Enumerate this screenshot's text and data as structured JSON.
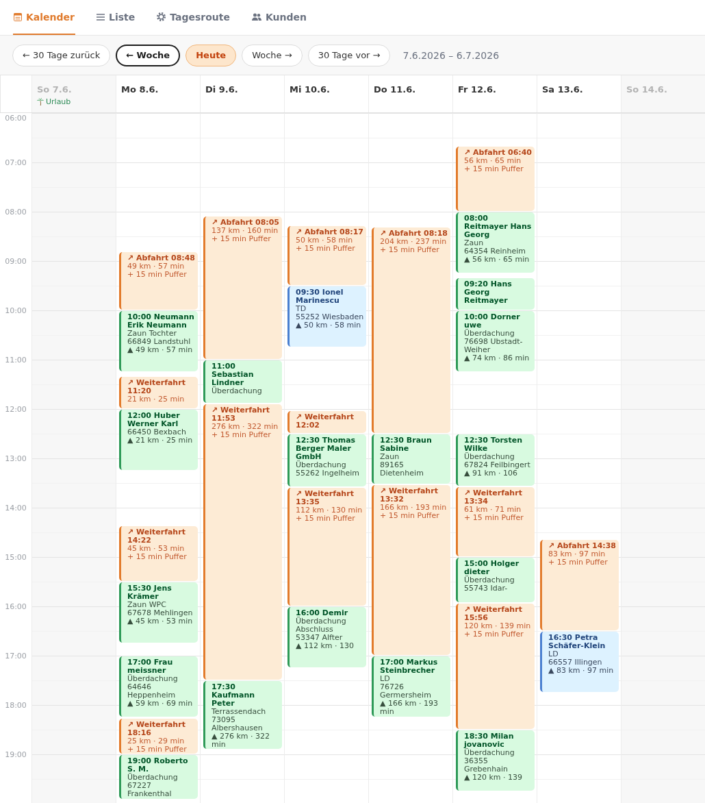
{
  "tabs": [
    {
      "label": "Kalender",
      "selected": true
    },
    {
      "label": "Liste",
      "selected": false
    },
    {
      "label": "Tagesroute",
      "selected": false
    },
    {
      "label": "Kunden",
      "selected": false
    }
  ],
  "toolbar": {
    "buttons": [
      {
        "label": "← 30 Tage zurück",
        "kind": "plain"
      },
      {
        "label": "← Woche",
        "kind": "focused"
      },
      {
        "label": "Heute",
        "kind": "today"
      },
      {
        "label": "Woche →",
        "kind": "plain"
      },
      {
        "label": "30 Tage vor →",
        "kind": "plain"
      }
    ],
    "range": "7.6.2026 – 6.7.2026"
  },
  "time_labels": [
    "06:00",
    "07:00",
    "08:00",
    "09:00",
    "10:00",
    "11:00",
    "12:00",
    "13:00",
    "14:00",
    "15:00",
    "16:00",
    "17:00",
    "18:00",
    "19:00"
  ],
  "days": [
    {
      "label": "So 7.6.",
      "disabled": true,
      "note": "Urlaub"
    },
    {
      "label": "Mo 8.6.",
      "disabled": false,
      "events": [
        {
          "kind": "travel",
          "title": "↗ Abfahrt 08:48",
          "lines": [
            "49 km · 57 min",
            "+ 15 min Puffer"
          ]
        },
        {
          "kind": "appointment",
          "color": "#2f9a58",
          "title": "10:00 Neumann Erik Neumann",
          "lines": [
            "Zaun Tochter",
            "66849 Landstuhl",
            "▲ 49 km · 57 min"
          ]
        },
        {
          "kind": "travel",
          "title": "↗ Weiterfahrt 11:20",
          "lines": [
            "21 km · 25 min"
          ]
        },
        {
          "kind": "appointment",
          "color": "#2f9a58",
          "title": "12:00 Huber Werner Karl",
          "lines": [
            "66450 Bexbach",
            "▲ 21 km · 25 min"
          ]
        },
        {
          "kind": "travel",
          "title": "↗ Weiterfahrt 14:22",
          "lines": [
            "45 km · 53 min",
            "+ 15 min Puffer"
          ]
        },
        {
          "kind": "appointment",
          "color": "#2f9a58",
          "title": "15:30 Jens Krämer",
          "lines": [
            "Zaun WPC",
            "67678 Mehlingen",
            "▲ 45 km · 53 min"
          ]
        },
        {
          "kind": "appointment",
          "color": "#2f9a58",
          "title": "17:00 Frau meissner",
          "lines": [
            "Überdachung",
            "64646 Heppenheim",
            "▲ 59 km · 69 min"
          ]
        },
        {
          "kind": "travel",
          "title": "↗ Weiterfahrt 18:16",
          "lines": [
            "25 km · 29 min",
            "+ 15 min Puffer"
          ]
        },
        {
          "kind": "appointment",
          "color": "#2f9a58",
          "title": "19:00 Roberto S. M.",
          "lines": [
            "Überdachung",
            "67227 Frankenthal"
          ]
        }
      ]
    },
    {
      "label": "Di 9.6.",
      "disabled": false,
      "events": [
        {
          "kind": "travel",
          "title": "↗ Abfahrt 08:05",
          "lines": [
            "137 km · 160 min",
            "+ 15 min Puffer"
          ]
        },
        {
          "kind": "appointment",
          "color": "#2f9a58",
          "title": "11:00 Sebastian Lindner",
          "lines": [
            "Überdachung"
          ]
        },
        {
          "kind": "travel",
          "title": "↗ Weiterfahrt 11:53",
          "lines": [
            "276 km · 322 min",
            "+ 15 min Puffer"
          ]
        },
        {
          "kind": "appointment",
          "color": "#2f9a58",
          "title": "17:30 Kaufmann Peter",
          "lines": [
            "Terrassendach",
            "73095 Albershausen",
            "▲ 276 km · 322 min"
          ]
        }
      ]
    },
    {
      "label": "Mi 10.6.",
      "disabled": false,
      "events": [
        {
          "kind": "travel",
          "title": "↗ Abfahrt 08:17",
          "lines": [
            "50 km · 58 min",
            "+ 15 min Puffer"
          ]
        },
        {
          "kind": "appointment",
          "color": "#4a7fd0",
          "title": "09:30 Ionel Marinescu",
          "lines": [
            "TD",
            "55252 Wiesbaden",
            "▲ 50 km · 58 min"
          ]
        },
        {
          "kind": "travel",
          "title": "↗ Weiterfahrt 12:02"
        },
        {
          "kind": "appointment",
          "color": "#2f9a58",
          "title": "12:30 Thomas Berger Maler GmbH",
          "lines": [
            "Überdachung",
            "55262 Ingelheim"
          ]
        },
        {
          "kind": "travel",
          "title": "↗ Weiterfahrt 13:35",
          "lines": [
            "112 km · 130 min",
            "+ 15 min Puffer"
          ]
        },
        {
          "kind": "appointment",
          "color": "#2f9a58",
          "title": "16:00 Demir",
          "lines": [
            "Überdachung Abschluss",
            "53347 Alfter",
            "▲ 112 km · 130"
          ]
        }
      ]
    },
    {
      "label": "Do 11.6.",
      "disabled": false,
      "events": [
        {
          "kind": "travel",
          "title": "↗ Abfahrt 08:18",
          "lines": [
            "204 km · 237 min",
            "+ 15 min Puffer"
          ]
        },
        {
          "kind": "appointment",
          "color": "#2f9a58",
          "title": "12:30 Braun Sabine",
          "lines": [
            "Zaun",
            "89165 Dietenheim"
          ]
        },
        {
          "kind": "travel",
          "title": "↗ Weiterfahrt 13:32",
          "lines": [
            "166 km · 193 min",
            "+ 15 min Puffer"
          ]
        },
        {
          "kind": "appointment",
          "color": "#2f9a58",
          "title": "17:00 Markus Steinbrecher",
          "lines": [
            "LD",
            "76726 Germersheim",
            "▲ 166 km · 193 min"
          ]
        }
      ]
    },
    {
      "label": "Fr 12.6.",
      "disabled": false,
      "events": [
        {
          "kind": "travel",
          "title": "↗ Abfahrt 06:40",
          "lines": [
            "56 km · 65 min",
            "+ 15 min Puffer"
          ]
        },
        {
          "kind": "appointment",
          "color": "#2f9a58",
          "title": "08:00 Reitmayer Hans Georg",
          "lines": [
            "Zaun",
            "64354 Reinheim",
            "▲ 56 km · 65 min"
          ]
        },
        {
          "kind": "appointment",
          "color": "#2f9a58",
          "title": "09:20 Hans Georg Reitmayer"
        },
        {
          "kind": "appointment",
          "color": "#2f9a58",
          "title": "10:00 Dorner uwe",
          "lines": [
            "Überdachung",
            "76698 Ubstadt-Weiher",
            "▲ 74 km · 86 min"
          ]
        },
        {
          "kind": "appointment",
          "color": "#2f9a58",
          "title": "12:30 Torsten Wilke",
          "lines": [
            "Überdachung",
            "67824 Feilbingert",
            "▲ 91 km · 106"
          ]
        },
        {
          "kind": "travel",
          "title": "↗ Weiterfahrt 13:34",
          "lines": [
            "61 km · 71 min",
            "+ 15 min Puffer"
          ]
        },
        {
          "kind": "appointment",
          "color": "#2f9a58",
          "title": "15:00 Holger dieter",
          "lines": [
            "Überdachung",
            "55743 Idar-"
          ]
        },
        {
          "kind": "travel",
          "title": "↗ Weiterfahrt 15:56",
          "lines": [
            "120 km · 139 min",
            "+ 15 min Puffer"
          ]
        },
        {
          "kind": "appointment",
          "color": "#2f9a58",
          "title": "18:30 Milan jovanovic",
          "lines": [
            "Überdachung",
            "36355 Grebenhain",
            "▲ 120 km · 139"
          ]
        }
      ]
    },
    {
      "label": "Sa 13.6.",
      "disabled": false,
      "events": [
        {
          "kind": "travel",
          "title": "↗ Abfahrt 14:38",
          "lines": [
            "83 km · 97 min",
            "+ 15 min Puffer"
          ]
        },
        {
          "kind": "appointment",
          "color": "#4a7fd0",
          "title": "16:30 Petra Schäfer-Klein",
          "lines": [
            "LD",
            "66557 Illingen",
            "▲ 83 km · 97 min"
          ]
        }
      ]
    },
    {
      "label": "So 14.6.",
      "disabled": true
    }
  ]
}
